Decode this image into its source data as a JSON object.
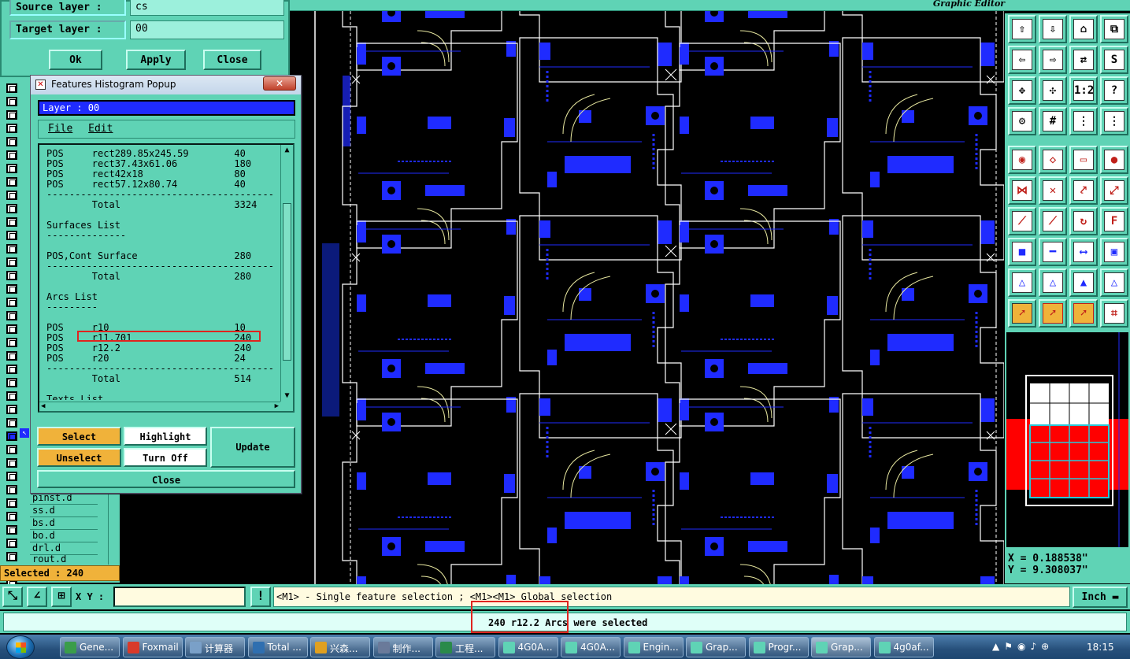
{
  "editor": {
    "title": "Graphic Editor"
  },
  "copy_dialog": {
    "source_label": "Source layer :",
    "source_value": "cs",
    "target_label": "Target layer :",
    "target_value": "00",
    "ok": "Ok",
    "apply": "Apply",
    "close": "Close"
  },
  "histogram": {
    "title": "Features Histogram Popup",
    "layer": "Layer :  00",
    "menu": {
      "file": "File",
      "edit": "Edit"
    },
    "lines": [
      "POS     rect289.85x245.59        40",
      "POS     rect37.43x61.06          180",
      "POS     rect42x18                80",
      "POS     rect57.12x80.74          40",
      "----------------------------------------",
      "        Total                    3324",
      "",
      "Surfaces List",
      "--------------",
      "",
      "POS,Cont Surface                 280",
      "----------------------------------------",
      "        Total                    280",
      "",
      "Arcs List",
      "---------",
      "",
      "POS     r10                      10",
      "POS     r11.701                  240",
      "POS     r12.2                    240",
      "POS     r20                      24",
      "----------------------------------------",
      "        Total                    514",
      "",
      "Texts List"
    ],
    "select": "Select",
    "highlight": "Highlight",
    "update": "Update",
    "unselect": "Unselect",
    "turn_off": "Turn Off",
    "close": "Close"
  },
  "layers": [
    "pinst.d",
    "ss.d",
    "bs.d",
    "bo.d",
    "drl.d",
    "rout.d"
  ],
  "selected": "Selected : 240",
  "command": {
    "xy_label": "X Y :",
    "xy_value": "",
    "hint": "<M1> - Single feature selection ; <M1><M1> Global selection",
    "units": "Inch"
  },
  "message": "240 r12.2 Arcs were selected",
  "coords": {
    "x": "X = 0.188538\"",
    "y": "Y = 9.308037\""
  },
  "taskbar": {
    "tasks": [
      "Gene...",
      "Foxmail",
      "计算器",
      "Total ...",
      "兴森...",
      "制作...",
      "工程...",
      "4G0A...",
      "4G0A...",
      "Engin...",
      "Grap...",
      "Progr...",
      "Grap...",
      "4g0af..."
    ],
    "time": "18:15"
  },
  "colors": {
    "panel": "#5fd3b5",
    "pad_blue": "#1f2bff",
    "highlight_box": "#e0241f",
    "canvas": "#000000"
  }
}
